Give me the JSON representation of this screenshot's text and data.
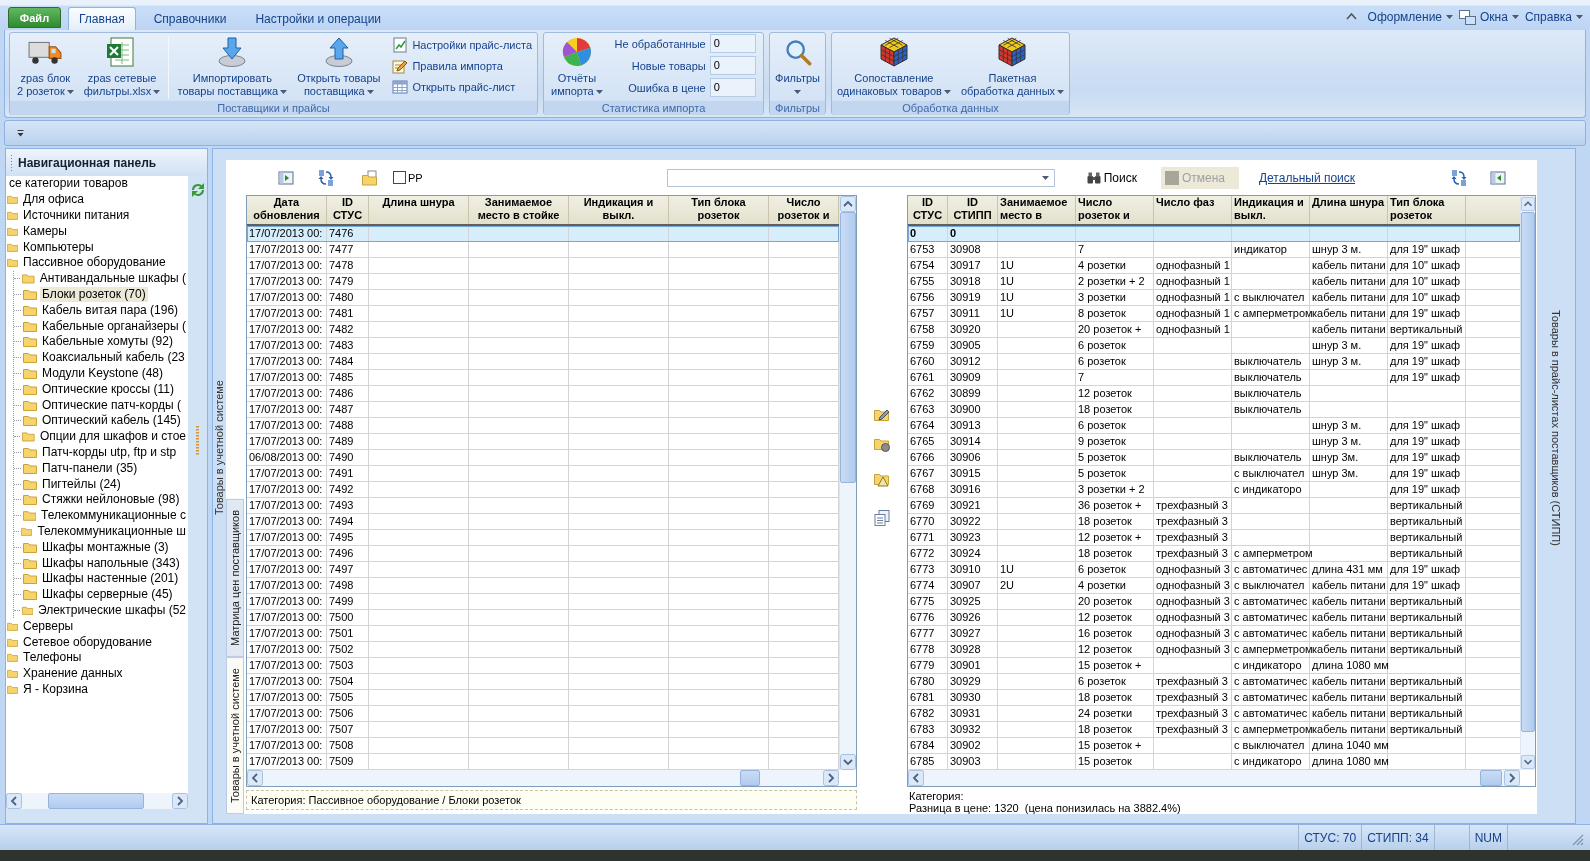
{
  "ribbon": {
    "file_button": "Файл",
    "tabs": [
      {
        "label": "Главная",
        "selected": true
      },
      {
        "label": "Справочники",
        "selected": false
      },
      {
        "label": "Настройки и операции",
        "selected": false
      }
    ],
    "right_menus": [
      {
        "label": "Оформление",
        "kind": "menu"
      },
      {
        "label": "Окна",
        "kind": "icon-menu"
      },
      {
        "label": "Справка",
        "kind": "menu"
      }
    ],
    "groups": [
      {
        "title": "Поставщики и прайсы",
        "items": [
          {
            "kind": "large",
            "lines": [
              "zpas блок",
              "2 розеток"
            ],
            "dropdown": true
          },
          {
            "kind": "large",
            "lines": [
              "zpas сетевые",
              "фильтры.xlsx"
            ],
            "dropdown": true
          },
          {
            "kind": "separator"
          },
          {
            "kind": "large",
            "lines": [
              "Импортировать",
              "товары поставщика"
            ],
            "dropdown": true
          },
          {
            "kind": "large",
            "lines": [
              "Открыть товары",
              "поставщика"
            ],
            "dropdown": true
          },
          {
            "kind": "small-stack",
            "buttons": [
              {
                "label": "Настройки прайс-листа"
              },
              {
                "label": "Правила импорта"
              },
              {
                "label": "Открыть прайс-лист"
              }
            ]
          }
        ]
      },
      {
        "title": "Статистика импорта",
        "items": [
          {
            "kind": "large",
            "lines": [
              "Отчёты",
              "импорта"
            ],
            "dropdown": true
          },
          {
            "kind": "stat-stack",
            "stats": [
              {
                "label": "Не обработанные",
                "value": "0"
              },
              {
                "label": "Новые товары",
                "value": "0"
              },
              {
                "label": "Ошибка в цене",
                "value": "0"
              }
            ]
          }
        ]
      },
      {
        "title": "Фильтры",
        "items": [
          {
            "kind": "large",
            "lines": [
              "Фильтры"
            ],
            "dropdown": true
          }
        ]
      },
      {
        "title": "Обработка данных",
        "items": [
          {
            "kind": "large",
            "lines": [
              "Сопоставление",
              "одинаковых товаров"
            ],
            "dropdown": true
          },
          {
            "kind": "large",
            "lines": [
              "Пакетная",
              "обработка данных"
            ],
            "dropdown": true
          }
        ]
      }
    ]
  },
  "navigation_panel": {
    "title": "Навигационная панель",
    "tree": [
      {
        "label": "се категории товаров",
        "selected": false,
        "children": [
          {
            "label": "Для офиса",
            "selected": false
          },
          {
            "label": "Источники питания",
            "selected": false
          },
          {
            "label": "Камеры",
            "selected": false
          },
          {
            "label": "Компьютеры",
            "selected": false
          },
          {
            "label": "Пассивное оборудование",
            "selected": false,
            "children": [
              {
                "label": "Антивандальные шкафы (",
                "selected": false
              },
              {
                "label": "Блоки розеток (70)",
                "selected": true
              },
              {
                "label": "Кабель витая пара (196)",
                "selected": false
              },
              {
                "label": "Кабельные органайзеры (",
                "selected": false
              },
              {
                "label": "Кабельные хомуты (92)",
                "selected": false
              },
              {
                "label": "Коаксиальный кабель (23",
                "selected": false
              },
              {
                "label": "Модули Keystone (48)",
                "selected": false
              },
              {
                "label": "Оптические кроссы (11)",
                "selected": false
              },
              {
                "label": "Оптические патч-корды (",
                "selected": false
              },
              {
                "label": "Оптический кабель (145)",
                "selected": false
              },
              {
                "label": "Опции для шкафов и стое",
                "selected": false
              },
              {
                "label": "Патч-корды utp, ftp и stp",
                "selected": false
              },
              {
                "label": "Патч-панели (35)",
                "selected": false
              },
              {
                "label": "Пигтейлы (24)",
                "selected": false
              },
              {
                "label": "Стяжки нейлоновые (98)",
                "selected": false
              },
              {
                "label": "Телекоммуникационные с",
                "selected": false
              },
              {
                "label": "Телекоммуникационные ш",
                "selected": false
              },
              {
                "label": "Шкафы монтажные (3)",
                "selected": false
              },
              {
                "label": "Шкафы напольные (343)",
                "selected": false
              },
              {
                "label": "Шкафы настенные (201)",
                "selected": false
              },
              {
                "label": "Шкафы серверные (45)",
                "selected": false
              },
              {
                "label": "Электрические шкафы (52",
                "selected": false
              }
            ]
          },
          {
            "label": "Серверы",
            "selected": false
          },
          {
            "label": "Сетевое оборудование",
            "selected": false
          },
          {
            "label": "Телефоны",
            "selected": false
          },
          {
            "label": "Хранение данных",
            "selected": false
          },
          {
            "label": "Я - Корзина",
            "selected": false
          }
        ]
      }
    ]
  },
  "side_label": "Товары в учетной системе",
  "view_tabs": [
    {
      "label": "Матрица цен поставщиков",
      "selected": false
    },
    {
      "label": "Товары в учетной системе",
      "selected": true
    }
  ],
  "toolbar": {
    "checkbox": {
      "label": "РР",
      "checked": false
    },
    "search_button": "Поиск",
    "cancel_button": {
      "label": "Отмена",
      "disabled": true
    },
    "detail_link": "Детальный поиск"
  },
  "system_table": {
    "columns": [
      "Дата обновления",
      "ID СТУС",
      "Длина шнура",
      "Занимаемое место в стойке",
      "Индикация и выкл.",
      "Тип блока розеток",
      "Число розеток и"
    ],
    "rows": [
      {
        "updated": "17/07/2013 00:",
        "id_stus": "7476",
        "selected": true
      },
      {
        "updated": "17/07/2013 00:",
        "id_stus": "7477",
        "selected": false
      },
      {
        "updated": "17/07/2013 00:",
        "id_stus": "7478",
        "selected": false
      },
      {
        "updated": "17/07/2013 00:",
        "id_stus": "7479",
        "selected": false
      },
      {
        "updated": "17/07/2013 00:",
        "id_stus": "7480",
        "selected": false
      },
      {
        "updated": "17/07/2013 00:",
        "id_stus": "7481",
        "selected": false
      },
      {
        "updated": "17/07/2013 00:",
        "id_stus": "7482",
        "selected": false
      },
      {
        "updated": "17/07/2013 00:",
        "id_stus": "7483",
        "selected": false
      },
      {
        "updated": "17/07/2013 00:",
        "id_stus": "7484",
        "selected": false
      },
      {
        "updated": "17/07/2013 00:",
        "id_stus": "7485",
        "selected": false
      },
      {
        "updated": "17/07/2013 00:",
        "id_stus": "7486",
        "selected": false
      },
      {
        "updated": "17/07/2013 00:",
        "id_stus": "7487",
        "selected": false
      },
      {
        "updated": "17/07/2013 00:",
        "id_stus": "7488",
        "selected": false
      },
      {
        "updated": "17/07/2013 00:",
        "id_stus": "7489",
        "selected": false
      },
      {
        "updated": "06/08/2013 00:",
        "id_stus": "7490",
        "selected": false
      },
      {
        "updated": "17/07/2013 00:",
        "id_stus": "7491",
        "selected": false
      },
      {
        "updated": "17/07/2013 00:",
        "id_stus": "7492",
        "selected": false
      },
      {
        "updated": "17/07/2013 00:",
        "id_stus": "7493",
        "selected": false
      },
      {
        "updated": "17/07/2013 00:",
        "id_stus": "7494",
        "selected": false
      },
      {
        "updated": "17/07/2013 00:",
        "id_stus": "7495",
        "selected": false
      },
      {
        "updated": "17/07/2013 00:",
        "id_stus": "7496",
        "selected": false
      },
      {
        "updated": "17/07/2013 00:",
        "id_stus": "7497",
        "selected": false
      },
      {
        "updated": "17/07/2013 00:",
        "id_stus": "7498",
        "selected": false
      },
      {
        "updated": "17/07/2013 00:",
        "id_stus": "7499",
        "selected": false
      },
      {
        "updated": "17/07/2013 00:",
        "id_stus": "7500",
        "selected": false
      },
      {
        "updated": "17/07/2013 00:",
        "id_stus": "7501",
        "selected": false
      },
      {
        "updated": "17/07/2013 00:",
        "id_stus": "7502",
        "selected": false
      },
      {
        "updated": "17/07/2013 00:",
        "id_stus": "7503",
        "selected": false
      },
      {
        "updated": "17/07/2013 00:",
        "id_stus": "7504",
        "selected": false
      },
      {
        "updated": "17/07/2013 00:",
        "id_stus": "7505",
        "selected": false
      },
      {
        "updated": "17/07/2013 00:",
        "id_stus": "7506",
        "selected": false
      },
      {
        "updated": "17/07/2013 00:",
        "id_stus": "7507",
        "selected": false
      },
      {
        "updated": "17/07/2013 00:",
        "id_stus": "7508",
        "selected": false
      },
      {
        "updated": "17/07/2013 00:",
        "id_stus": "7509",
        "selected": false
      }
    ],
    "category": "Категория: Пассивное оборудование / Блоки розеток"
  },
  "supplier_table": {
    "columns": [
      "ID СТУС",
      "ID СТИПП",
      "Занимаемое место в",
      "Число розеток и",
      "Число фаз",
      "Индикация и выкл.",
      "Длина шнура",
      "Тип блока розеток"
    ],
    "top_row": {
      "id_stus": "0",
      "id_stipp": "0",
      "selected": true
    },
    "rows": [
      {
        "id_stus": "6753",
        "id_stipp": "30908",
        "outlets": "7",
        "indication": "индикатор",
        "cord_length": "шнур 3 м.",
        "block_type": "для 19\" шкаф",
        "selected": false
      },
      {
        "id_stus": "6754",
        "id_stipp": "30917",
        "rack_space": "1U",
        "outlets": "4 розетки",
        "phases": "однофазный 1",
        "cord_length": "кабель питани",
        "block_type": "для 10\" шкаф",
        "selected": false
      },
      {
        "id_stus": "6755",
        "id_stipp": "30918",
        "rack_space": "1U",
        "outlets": "2 розетки + 2",
        "phases": "однофазный 1",
        "cord_length": "кабель питани",
        "block_type": "для 10\" шкаф",
        "selected": false
      },
      {
        "id_stus": "6756",
        "id_stipp": "30919",
        "rack_space": "1U",
        "outlets": "3 розетки",
        "phases": "однофазный 1",
        "indication": "с выключател",
        "cord_length": "кабель питани",
        "block_type": "для 10\" шкаф",
        "selected": false
      },
      {
        "id_stus": "6757",
        "id_stipp": "30911",
        "rack_space": "1U",
        "outlets": "8 розеток",
        "phases": "однофазный 1",
        "indication": "с амперметром",
        "cord_length": "кабель питани",
        "block_type": "для 19\" шкаф",
        "selected": false
      },
      {
        "id_stus": "6758",
        "id_stipp": "30920",
        "outlets": "20 розеток +",
        "phases": "однофазный 1",
        "cord_length": "кабель питани",
        "block_type": "вертикальный",
        "selected": false
      },
      {
        "id_stus": "6759",
        "id_stipp": "30905",
        "outlets": "6 розеток",
        "cord_length": "шнур 3 м.",
        "block_type": "для 19\" шкаф",
        "selected": false
      },
      {
        "id_stus": "6760",
        "id_stipp": "30912",
        "outlets": "6 розеток",
        "indication": "выключатель",
        "cord_length": "шнур 3 м.",
        "block_type": "для 19\" шкаф",
        "selected": false
      },
      {
        "id_stus": "6761",
        "id_stipp": "30909",
        "outlets": "7",
        "indication": "выключатель",
        "block_type": "для 19\" шкаф",
        "selected": false
      },
      {
        "id_stus": "6762",
        "id_stipp": "30899",
        "outlets": "12 розеток",
        "indication": "выключатель",
        "selected": false
      },
      {
        "id_stus": "6763",
        "id_stipp": "30900",
        "outlets": "18 розеток",
        "indication": "выключатель",
        "selected": false
      },
      {
        "id_stus": "6764",
        "id_stipp": "30913",
        "outlets": "6 розеток",
        "cord_length": "шнур 3 м.",
        "block_type": "для 19\" шкаф",
        "selected": false
      },
      {
        "id_stus": "6765",
        "id_stipp": "30914",
        "outlets": "9 розеток",
        "cord_length": "шнур 3 м.",
        "block_type": "для 19\" шкаф",
        "selected": false
      },
      {
        "id_stus": "6766",
        "id_stipp": "30906",
        "outlets": "5 розеток",
        "indication": "выключатель",
        "cord_length": "шнур 3м.",
        "block_type": "для 19\" шкаф",
        "selected": false
      },
      {
        "id_stus": "6767",
        "id_stipp": "30915",
        "outlets": "5 розеток",
        "indication": "с выключател",
        "cord_length": "шнур 3м.",
        "block_type": "для 19\" шкаф",
        "selected": false
      },
      {
        "id_stus": "6768",
        "id_stipp": "30916",
        "outlets": "3 розетки + 2",
        "indication": "с индикаторо",
        "block_type": "для 19\" шкаф",
        "selected": false
      },
      {
        "id_stus": "6769",
        "id_stipp": "30921",
        "outlets": "36 розеток +",
        "phases": "трехфазный 3",
        "block_type": "вертикальный",
        "selected": false
      },
      {
        "id_stus": "6770",
        "id_stipp": "30922",
        "outlets": "18 розеток",
        "phases": "трехфазный 3",
        "block_type": "вертикальный",
        "selected": false
      },
      {
        "id_stus": "6771",
        "id_stipp": "30923",
        "outlets": "12 розеток +",
        "phases": "трехфазный 3",
        "block_type": "вертикальный",
        "selected": false
      },
      {
        "id_stus": "6772",
        "id_stipp": "30924",
        "outlets": "18 розеток",
        "phases": "трехфазный 3",
        "indication": "с амперметром",
        "block_type": "вертикальный",
        "selected": false
      },
      {
        "id_stus": "6773",
        "id_stipp": "30910",
        "rack_space": "1U",
        "outlets": "6 розеток",
        "phases": "однофазный 3",
        "indication": "с автоматичес",
        "cord_length": "длина 431 мм",
        "block_type": "для 19\" шкаф",
        "selected": false
      },
      {
        "id_stus": "6774",
        "id_stipp": "30907",
        "rack_space": "2U",
        "outlets": "4 розетки",
        "phases": "однофазный 3",
        "indication": "с выключател",
        "cord_length": "кабель питани",
        "block_type": "для 19\" шкаф",
        "selected": false
      },
      {
        "id_stus": "6775",
        "id_stipp": "30925",
        "outlets": "20 розеток",
        "phases": "однофазный 3",
        "indication": "с автоматичес",
        "cord_length": "кабель питани",
        "block_type": "вертикальный",
        "selected": false
      },
      {
        "id_stus": "6776",
        "id_stipp": "30926",
        "outlets": "12 розеток",
        "phases": "однофазный 3",
        "indication": "с автоматичес",
        "cord_length": "кабель питани",
        "block_type": "вертикальный",
        "selected": false
      },
      {
        "id_stus": "6777",
        "id_stipp": "30927",
        "outlets": "16 розеток",
        "phases": "однофазный 3",
        "indication": "с автоматичес",
        "cord_length": "кабель питани",
        "block_type": "вертикальный",
        "selected": false
      },
      {
        "id_stus": "6778",
        "id_stipp": "30928",
        "outlets": "12 розеток",
        "phases": "однофазный 3",
        "indication": "с амперметром",
        "cord_length": "кабель питани",
        "block_type": "вертикальный",
        "selected": false
      },
      {
        "id_stus": "6779",
        "id_stipp": "30901",
        "outlets": "15 розеток +",
        "indication": "с индикаторо",
        "cord_length": "длина 1080 мм",
        "selected": false
      },
      {
        "id_stus": "6780",
        "id_stipp": "30929",
        "outlets": "6 розеток",
        "phases": "трехфазный 3",
        "indication": "с автоматичес",
        "cord_length": "кабель питани",
        "block_type": "вертикальный",
        "selected": false
      },
      {
        "id_stus": "6781",
        "id_stipp": "30930",
        "outlets": "18 розеток",
        "phases": "трехфазный 3",
        "indication": "с автоматичес",
        "cord_length": "кабель питани",
        "block_type": "вертикальный",
        "selected": false
      },
      {
        "id_stus": "6782",
        "id_stipp": "30931",
        "outlets": "24 розетки",
        "phases": "трехфазный 3",
        "indication": "с автоматичес",
        "cord_length": "кабель питани",
        "block_type": "вертикальный",
        "selected": false
      },
      {
        "id_stus": "6783",
        "id_stipp": "30932",
        "outlets": "18 розеток",
        "phases": "трехфазный 3",
        "indication": "с амперметром",
        "cord_length": "кабель питани",
        "block_type": "вертикальный",
        "selected": false
      },
      {
        "id_stus": "6784",
        "id_stipp": "30902",
        "outlets": "15 розеток +",
        "indication": "с выключател",
        "cord_length": "длина 1040 мм",
        "selected": false
      },
      {
        "id_stus": "6785",
        "id_stipp": "30903",
        "outlets": "15 розеток",
        "indication": "с индикаторо",
        "cord_length": "длина 1080 мм",
        "selected": false
      }
    ],
    "category": "Категория:",
    "price_difference": "Разница в цене: 1320  (цена понизилась на 3882.4%)"
  },
  "right_side_label": "Товары в прайс-листах поставщиков (СТИПП)",
  "status_bar": {
    "panels": [
      "СТУС: 70",
      "СТИПП: 34",
      "NUM"
    ]
  }
}
